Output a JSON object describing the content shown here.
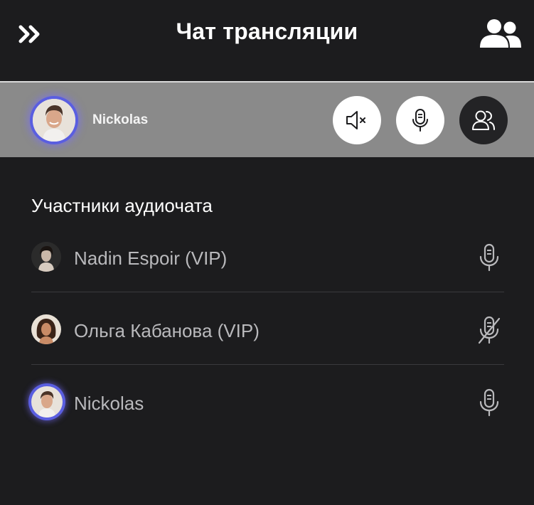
{
  "header": {
    "title": "Чат трансляции",
    "collapse_icon": "double-chevron-right-icon",
    "users_icon": "users-icon"
  },
  "current_user": {
    "name": "Nickolas",
    "controls": [
      {
        "icon": "speaker-mute-icon"
      },
      {
        "icon": "microphone-icon"
      },
      {
        "icon": "participants-icon"
      }
    ]
  },
  "participants": {
    "title": "Участники аудиочата",
    "items": [
      {
        "name": "Nadin Espoir (VIP)",
        "mic": "microphone-icon"
      },
      {
        "name": "Ольга Кабанова (VIP)",
        "mic": "microphone-off-icon"
      },
      {
        "name": "Nickolas",
        "mic": "microphone-icon"
      }
    ]
  },
  "colors": {
    "background": "#1c1c1e",
    "current_bar": "#8a8a8a",
    "accent_ring": "#5a5ee0"
  }
}
